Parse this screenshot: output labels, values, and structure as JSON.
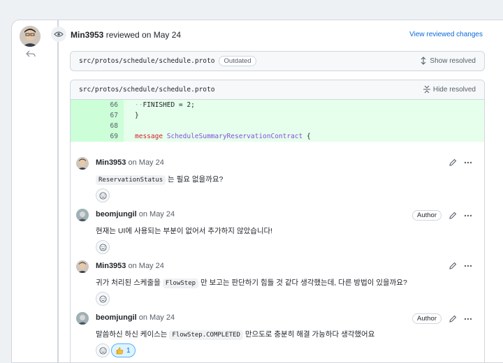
{
  "review": {
    "user": "Min3953",
    "action": "reviewed on May 24",
    "view_changes": "View reviewed changes"
  },
  "outdated_file": {
    "path": "src/protos/schedule/schedule.proto",
    "badge": "Outdated",
    "toggle": "Show resolved"
  },
  "resolved_file": {
    "path": "src/protos/schedule/schedule.proto",
    "toggle": "Hide resolved",
    "lines": [
      {
        "num": "66",
        "text": "FINISHED = 2;"
      },
      {
        "num": "67",
        "text": "}"
      },
      {
        "num": "68",
        "text": ""
      },
      {
        "num": "69",
        "text": "message ScheduleSummaryReservationContract {"
      }
    ]
  },
  "comments": [
    {
      "user": "Min3953",
      "date": "on May 24",
      "code": "ReservationStatus",
      "text_after": " 는 필요 없을까요?",
      "author": ""
    },
    {
      "user": "beomjungil",
      "date": "on May 24",
      "text": "현재는 UI에 사용되는 부분이 없어서 추가하지 않았습니다!",
      "author": "Author"
    },
    {
      "user": "Min3953",
      "date": "on May 24",
      "text_before": "귀가 처리된 스케줄을 ",
      "code": "FlowStep",
      "text_after": " 만 보고는 판단하기 힘들 것 같다 생각했는데, 다른 방법이 있을까요?",
      "author": ""
    },
    {
      "user": "beomjungil",
      "date": "on May 24",
      "text_before": "말씀하신 하신 케이스는 ",
      "code": "FlowStep.COMPLETED",
      "text_after": " 만으도로 충분히 해결 가능하다 생각했어요",
      "author": "Author",
      "reaction_count": "1"
    }
  ],
  "icons": {
    "eye": "eye-icon",
    "reply": "reply-icon",
    "unfold": "unfold-icon",
    "fold": "fold-icon",
    "pencil": "pencil-icon",
    "kebab": "kebab-icon",
    "smiley": "smiley-icon",
    "thumbs": "thumbs-up-icon"
  },
  "colors": {
    "accent": "#0969da",
    "addition_bg": "#e6ffec",
    "addition_num_bg": "#ccffd8"
  }
}
